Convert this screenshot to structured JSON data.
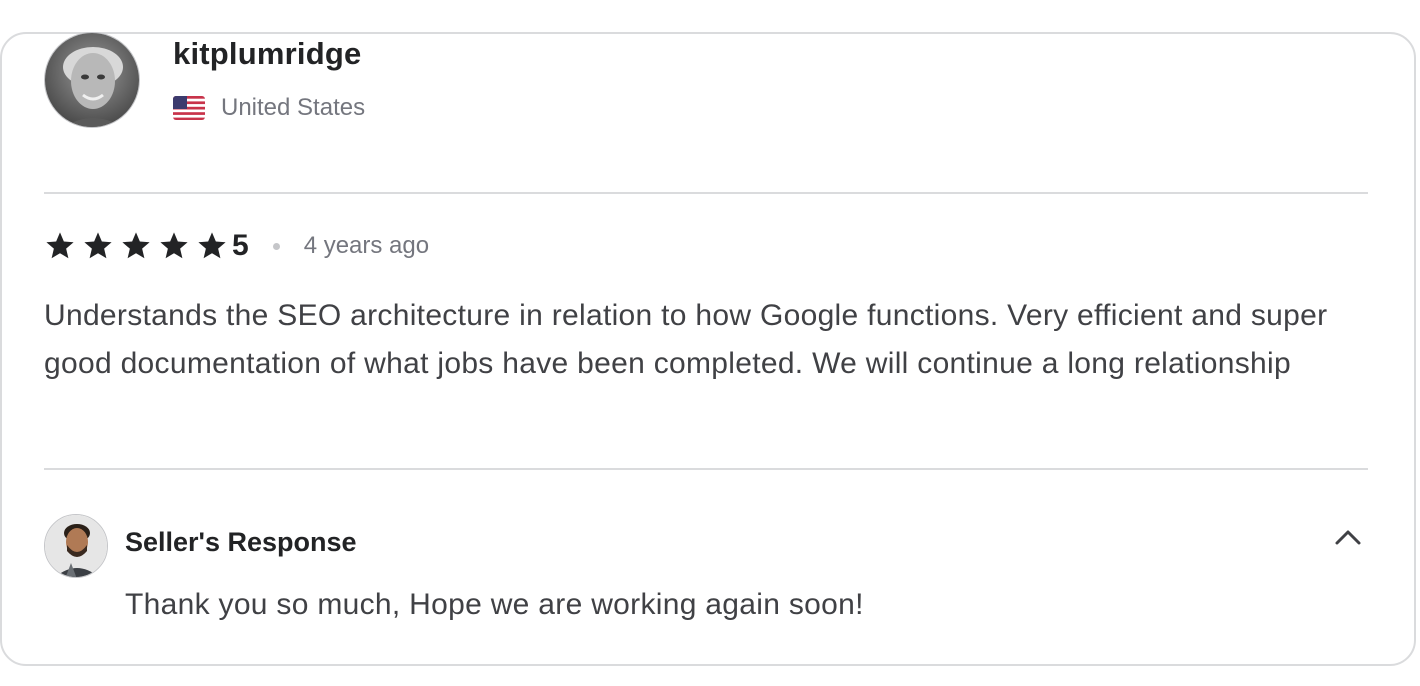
{
  "review": {
    "username": "kitplumridge",
    "country": "United States",
    "country_flag_icon": "us-flag-icon",
    "rating": {
      "value": "5",
      "stars_filled": 5,
      "stars_total": 5,
      "star_color": "#222325"
    },
    "time_ago": "4 years ago",
    "text": "Understands the SEO architecture in relation to how Google functions. Very efficient and super good documentation of what jobs have been completed. We will continue a long relationship"
  },
  "seller_response": {
    "title": "Seller's Response",
    "text": "Thank you so much, Hope we are working again soon!",
    "toggle_icon": "chevron-up-icon"
  },
  "colors": {
    "text_primary": "#222325",
    "text_secondary": "#74767e",
    "text_body": "#404145",
    "border": "#dadbdd"
  }
}
